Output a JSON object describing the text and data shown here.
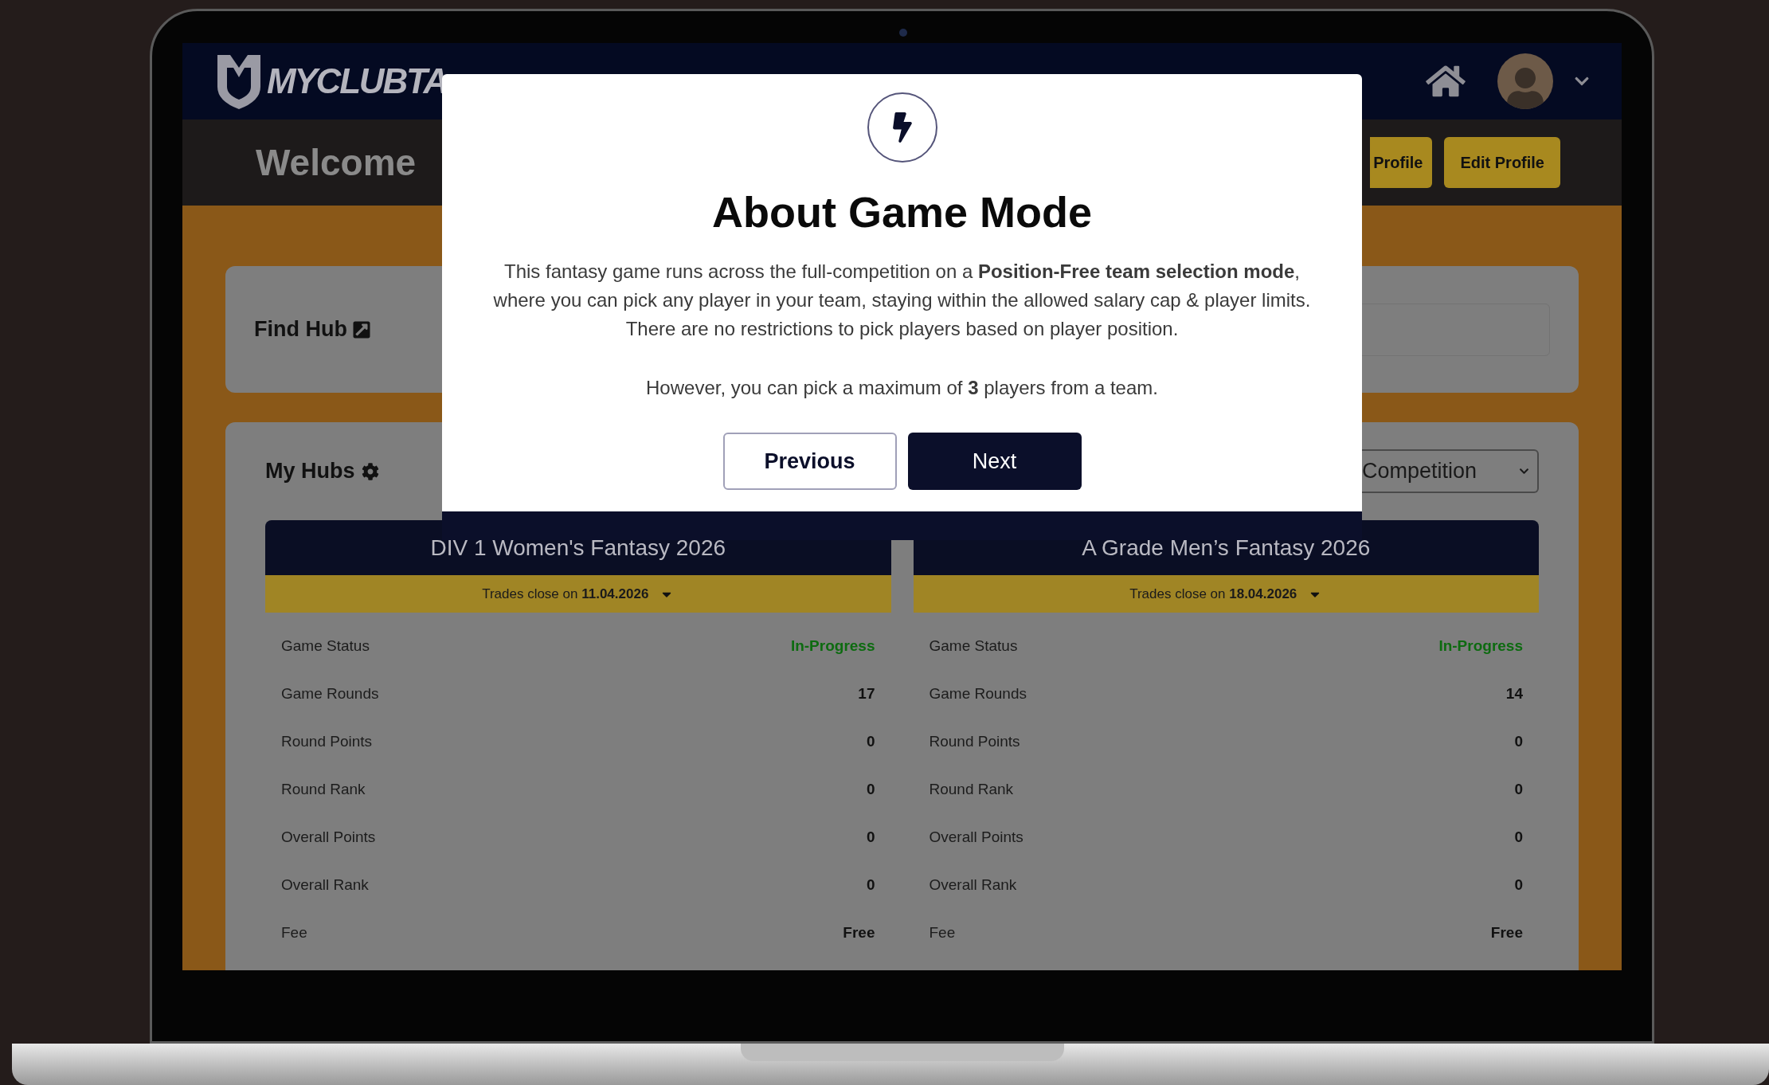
{
  "header": {
    "logo_text": "MYCLUBTA",
    "welcome": "Welcome",
    "buttons": [
      "Profile",
      "Edit Profile"
    ]
  },
  "find_hub": {
    "title": "Find Hub"
  },
  "my_hubs": {
    "title": "My Hubs",
    "filter_select": {
      "value": "Competition"
    },
    "hubs": [
      {
        "title": "DIV 1 Women's Fantasy 2026",
        "trades_label": "Trades close on",
        "trades_date": "11.04.2026",
        "rows": [
          {
            "label": "Game Status",
            "value": "In-Progress",
            "kind": "status"
          },
          {
            "label": "Game Rounds",
            "value": "17",
            "kind": "plain"
          },
          {
            "label": "Round Points",
            "value": "0",
            "kind": "plain"
          },
          {
            "label": "Round Rank",
            "value": "0",
            "kind": "plain"
          },
          {
            "label": "Overall Points",
            "value": "0",
            "kind": "plain"
          },
          {
            "label": "Overall Rank",
            "value": "0",
            "kind": "plain"
          },
          {
            "label": "Fee",
            "value": "Free",
            "kind": "plain"
          }
        ]
      },
      {
        "title": "A Grade Men’s Fantasy 2026",
        "trades_label": "Trades close on",
        "trades_date": "18.04.2026",
        "rows": [
          {
            "label": "Game Status",
            "value": "In-Progress",
            "kind": "status"
          },
          {
            "label": "Game Rounds",
            "value": "14",
            "kind": "plain"
          },
          {
            "label": "Round Points",
            "value": "0",
            "kind": "plain"
          },
          {
            "label": "Round Rank",
            "value": "0",
            "kind": "plain"
          },
          {
            "label": "Overall Points",
            "value": "0",
            "kind": "plain"
          },
          {
            "label": "Overall Rank",
            "value": "0",
            "kind": "plain"
          },
          {
            "label": "Fee",
            "value": "Free",
            "kind": "plain"
          }
        ]
      }
    ]
  },
  "modal": {
    "title": "About Game Mode",
    "paragraphs": [
      "This fantasy game runs across the full-competition on a **Position-Free team selection mode**, where you can pick any player in your team, staying within the allowed salary cap & player limits. There are no restrictions to pick players based on player position.",
      "However, you can pick a maximum of **3** players from a team."
    ],
    "buttons": [
      {
        "label": "Previous",
        "kind": "secondary"
      },
      {
        "label": "Next",
        "kind": "primary"
      }
    ]
  }
}
